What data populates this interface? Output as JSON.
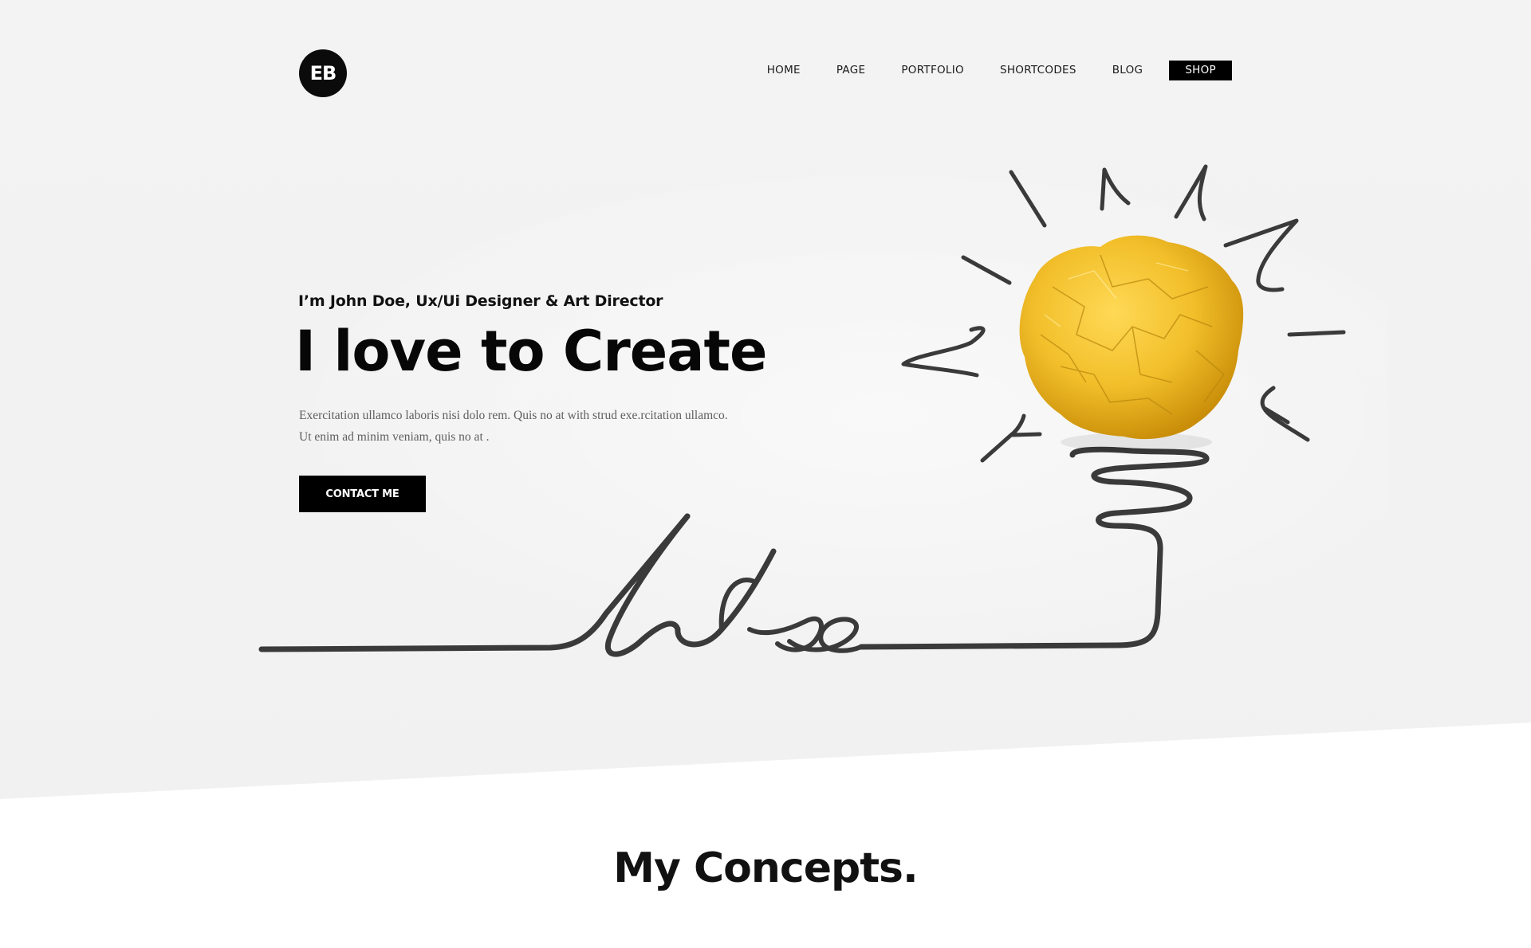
{
  "header": {
    "logo_text": "EB",
    "nav": [
      {
        "label": "HOME"
      },
      {
        "label": "PAGE"
      },
      {
        "label": "PORTFOLIO"
      },
      {
        "label": "SHORTCODES"
      },
      {
        "label": "BLOG"
      },
      {
        "label": "SHOP"
      }
    ]
  },
  "hero": {
    "subtitle": "I’m John Doe, Ux/Ui Designer & Art Director",
    "headline": "I love to Create",
    "description": "Exercitation ullamco laboris nisi dolo rem. Quis no at with strud exe.rcitation ullamco. Ut enim ad minim veniam, quis no at .",
    "cta_label": "CONTACT ME",
    "illustration": {
      "handwritten_word": "Idea",
      "icon": "crumpled-paper-lightbulb-icon",
      "colors": {
        "paper": "#f2bf2a",
        "ink": "#3a3a3a"
      }
    }
  },
  "concepts": {
    "title": "My Concepts."
  },
  "colors": {
    "background": "#f3f3f3",
    "accent": "#000000",
    "text": "#111111",
    "muted_text": "#5e5e5e"
  }
}
